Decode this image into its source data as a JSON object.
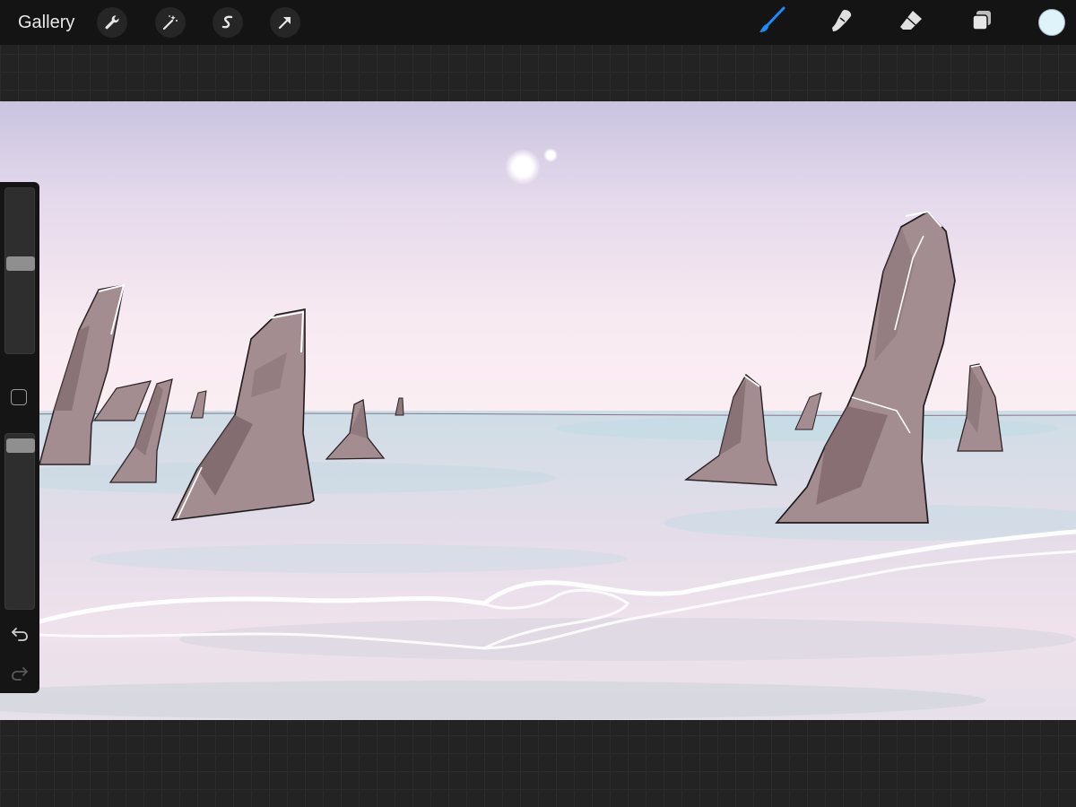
{
  "toolbar": {
    "gallery_label": "Gallery",
    "left_tools": [
      {
        "name": "actions",
        "icon": "wrench-icon"
      },
      {
        "name": "adjustments",
        "icon": "magic-wand-icon"
      },
      {
        "name": "selection",
        "icon": "selection-s-icon"
      },
      {
        "name": "transform",
        "icon": "arrow-cursor-icon"
      }
    ],
    "right_tools": [
      {
        "name": "brush",
        "icon": "brush-icon",
        "active": true,
        "color": "#1a8cff"
      },
      {
        "name": "smudge",
        "icon": "smudge-finger-icon",
        "active": false
      },
      {
        "name": "eraser",
        "icon": "eraser-icon",
        "active": false
      },
      {
        "name": "layers",
        "icon": "layers-icon",
        "active": false
      }
    ],
    "current_color": "#dff3fb"
  },
  "sidebar": {
    "brush_size_level": 0.55,
    "opacity_level": 0.98,
    "modify_icon": "square-icon",
    "undo_icon": "undo-arrow-icon",
    "redo_icon": "redo-arrow-icon",
    "redo_enabled": false
  },
  "canvas": {
    "sky_top": "#cdc7e0",
    "sky_mid": "#f7e6ef",
    "water": "#c9d9e2",
    "rock": "#a38d90",
    "rock_shadow": "#7a6367",
    "foam": "#ffffff",
    "moon": "#ffffff"
  }
}
